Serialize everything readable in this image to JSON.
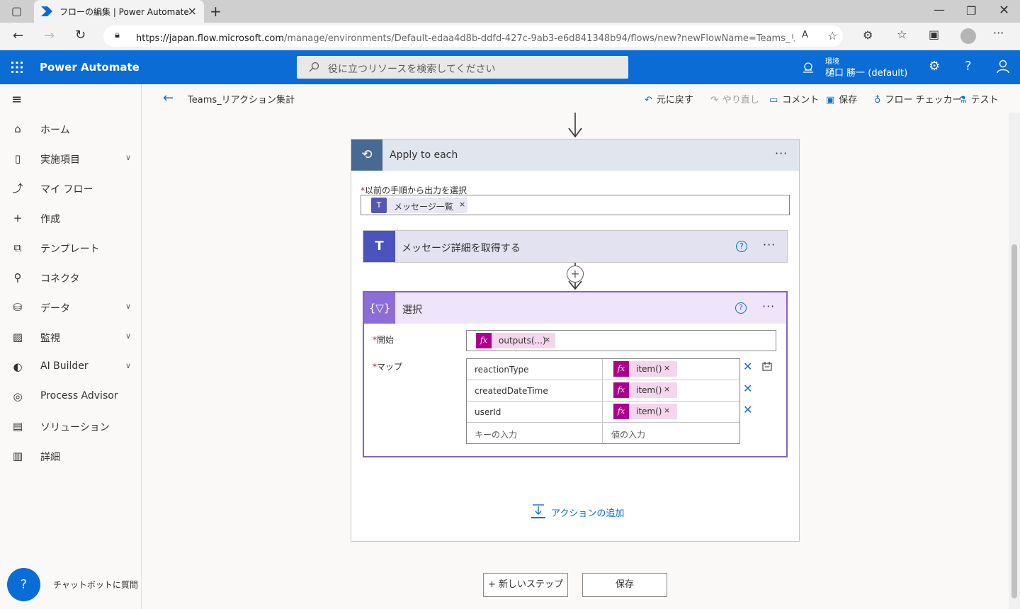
{
  "browser": {
    "tab_title": "フローの編集 | Power Automate",
    "url_host": "https://japan.flow.microsoft.com",
    "url_path": "/manage/environments/Default-edaa4d8b-ddfd-427c-9ab3-e6d841348b94/flows/new?newFlowName=Teams_リアク..."
  },
  "app": {
    "name": "Power Automate",
    "search_placeholder": "役に立つリソースを検索してください",
    "env_label": "環境",
    "env_name": "樋口 勝一 (default)"
  },
  "nav": {
    "items": [
      {
        "label": "ホーム",
        "icon": "home-icon"
      },
      {
        "label": "実施項目",
        "icon": "clipboard-icon",
        "expand": true
      },
      {
        "label": "マイ フロー",
        "icon": "flow-icon"
      },
      {
        "label": "作成",
        "icon": "plus-icon"
      },
      {
        "label": "テンプレート",
        "icon": "template-icon"
      },
      {
        "label": "コネクタ",
        "icon": "connector-icon"
      },
      {
        "label": "データ",
        "icon": "database-icon",
        "expand": true
      },
      {
        "label": "監視",
        "icon": "monitor-icon",
        "expand": true
      },
      {
        "label": "AI Builder",
        "icon": "ai-icon",
        "expand": true
      },
      {
        "label": "Process Advisor",
        "icon": "process-icon"
      },
      {
        "label": "ソリューション",
        "icon": "solution-icon"
      },
      {
        "label": "詳細",
        "icon": "book-icon"
      }
    ],
    "chatbot_label": "チャットボットに質問"
  },
  "command_bar": {
    "flow_name": "Teams_リアクション集計",
    "undo": "元に戻す",
    "redo": "やり直し",
    "comment": "コメント",
    "save": "保存",
    "checker": "フロー チェッカー",
    "test": "テスト"
  },
  "apply_each": {
    "title": "Apply to each",
    "field_label": "以前の手順から出力を選択",
    "token": "メッセージ一覧"
  },
  "teams_action": {
    "title": "メッセージ詳細を取得する"
  },
  "select_action": {
    "title": "選択",
    "from_label": "開始",
    "from_token": "outputs(...)",
    "map_label": "マップ",
    "rows": [
      {
        "key": "reactionType",
        "value": "item()"
      },
      {
        "key": "createdDateTime",
        "value": "item()"
      },
      {
        "key": "userId",
        "value": "item()"
      }
    ],
    "key_placeholder": "キーの入力",
    "value_placeholder": "値の入力"
  },
  "add_action": "アクションの追加",
  "buttons": {
    "new_step": "+ 新しいステップ",
    "save": "保存"
  }
}
